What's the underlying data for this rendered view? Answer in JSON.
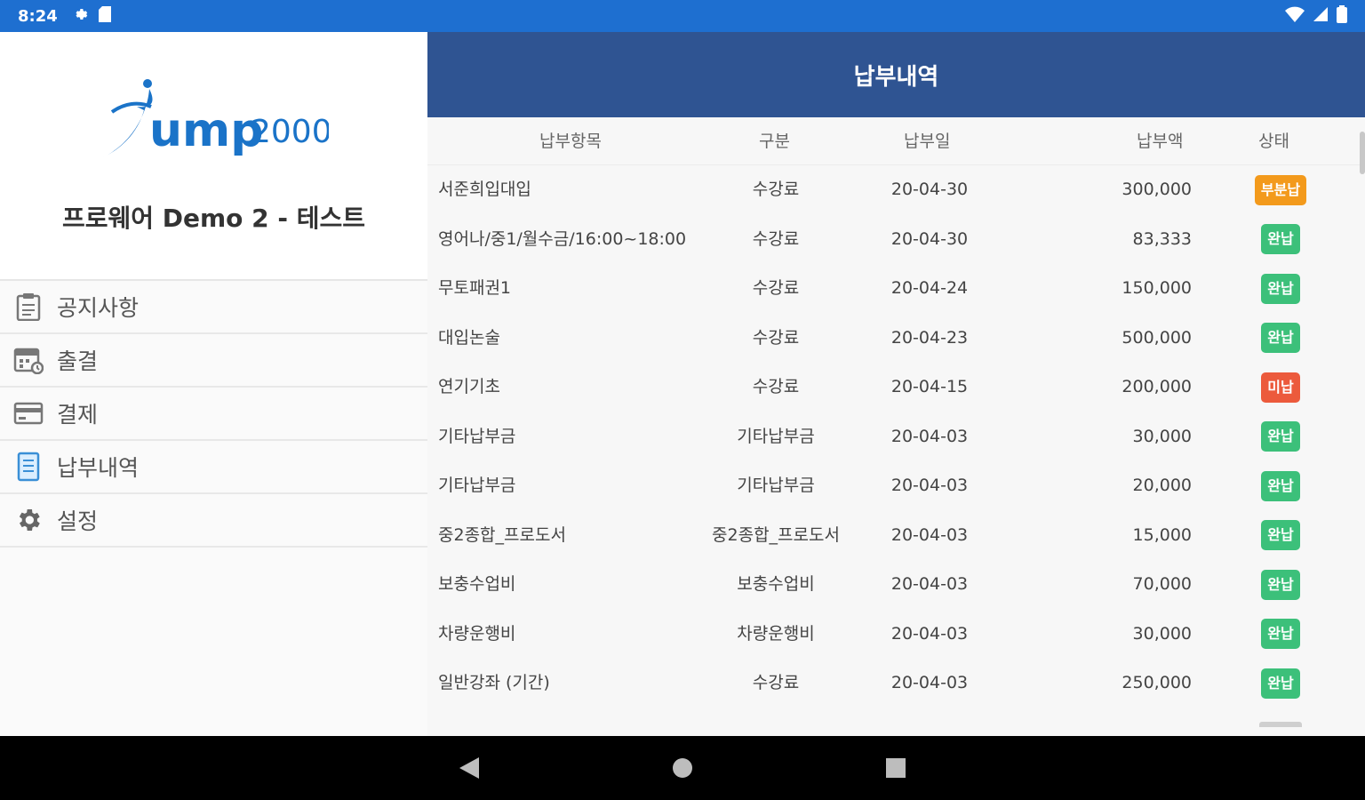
{
  "status_bar": {
    "time": "8:24"
  },
  "drawer": {
    "academy_name": "프로웨어 Demo 2 - 테스트",
    "menu": [
      {
        "label": "공지사항",
        "icon": "clipboard-icon"
      },
      {
        "label": "출결",
        "icon": "calendar-icon"
      },
      {
        "label": "결제",
        "icon": "credit-card-icon"
      },
      {
        "label": "납부내역",
        "icon": "receipt-icon"
      },
      {
        "label": "설정",
        "icon": "gear-icon"
      }
    ]
  },
  "main": {
    "title": "납부내역",
    "columns": {
      "item": "납부항목",
      "type": "구분",
      "date": "납부일",
      "amount": "납부액",
      "status": "상태"
    },
    "rows": [
      {
        "item": "서준희입대입",
        "type": "수강료",
        "date": "20-04-30",
        "amount": "300,000",
        "status": "부분납"
      },
      {
        "item": "영어나/중1/월수금/16:00~18:00",
        "type": "수강료",
        "date": "20-04-30",
        "amount": "83,333",
        "status": "완납"
      },
      {
        "item": "무토패권1",
        "type": "수강료",
        "date": "20-04-24",
        "amount": "150,000",
        "status": "완납"
      },
      {
        "item": "대입논술",
        "type": "수강료",
        "date": "20-04-23",
        "amount": "500,000",
        "status": "완납"
      },
      {
        "item": "연기기초",
        "type": "수강료",
        "date": "20-04-15",
        "amount": "200,000",
        "status": "미납"
      },
      {
        "item": "기타납부금",
        "type": "기타납부금",
        "date": "20-04-03",
        "amount": "30,000",
        "status": "완납"
      },
      {
        "item": "기타납부금",
        "type": "기타납부금",
        "date": "20-04-03",
        "amount": "20,000",
        "status": "완납"
      },
      {
        "item": "중2종합_프로도서",
        "type": "중2종합_프로도서",
        "date": "20-04-03",
        "amount": "15,000",
        "status": "완납"
      },
      {
        "item": "보충수업비",
        "type": "보충수업비",
        "date": "20-04-03",
        "amount": "70,000",
        "status": "완납"
      },
      {
        "item": "차량운행비",
        "type": "차량운행비",
        "date": "20-04-03",
        "amount": "30,000",
        "status": "완납"
      },
      {
        "item": "일반강좌 (기간)",
        "type": "수강료",
        "date": "20-04-03",
        "amount": "250,000",
        "status": "완납"
      }
    ]
  },
  "colors": {
    "status_bar": "#1e6fd0",
    "toolbar": "#2f5492",
    "badge_full": "#3cc07a",
    "badge_partial": "#f39a1c",
    "badge_unpaid": "#ec5a3c",
    "logo_blue": "#1a73c8"
  },
  "badge_colors": {
    "완납": "#3cc07a",
    "부분납": "#f39a1c",
    "미납": "#ec5a3c"
  }
}
